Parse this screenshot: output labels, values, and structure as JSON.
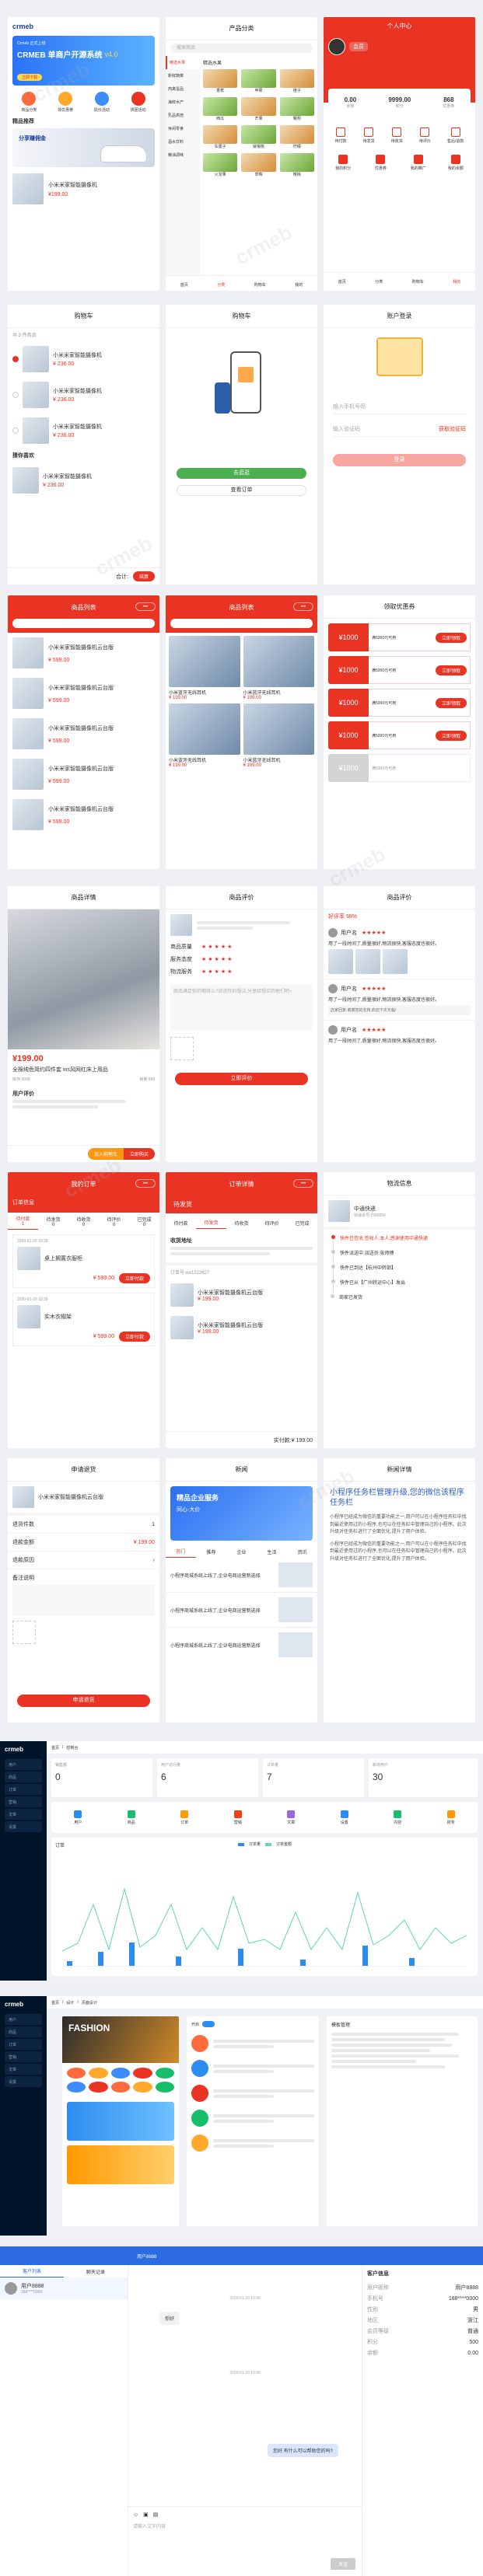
{
  "brand": "crmeb",
  "watermark": "crmeb",
  "colors": {
    "primary": "#e93323",
    "admin_side": "#001529",
    "admin_blue": "#2d8cf0"
  },
  "home": {
    "banner_title": "CRMEB 单商户开源系统",
    "banner_version": "v4.0",
    "banner_small": "Crmeb 正式上线",
    "banner_cta": "立即下载",
    "nav": [
      "商品分类",
      "领优惠券",
      "砍价活动",
      "拼团活动"
    ],
    "notice": "精品推荐",
    "promo": "分享赚佣金",
    "product": "小米米家智能摄像机",
    "price": "¥199.00"
  },
  "category": {
    "title": "产品分类",
    "search": "搜索商品",
    "side": [
      "精选水果",
      "新鲜蔬菜",
      "肉禽蛋品",
      "海鲜水产",
      "乳品烘焙",
      "休闲零食",
      "酒水饮料",
      "粮油调味"
    ],
    "sub": "精选水果",
    "items": [
      "香蕉",
      "苹果",
      "橙子",
      "西瓜",
      "芒果",
      "葡萄",
      "车厘子",
      "猕猴桃",
      "柠檬",
      "火龙果",
      "草莓",
      "樱桃"
    ]
  },
  "user": {
    "title": "个人中心",
    "name": "会员",
    "stats": [
      "余额",
      "积分",
      "优惠券"
    ],
    "values": [
      "0.00",
      "9999.00",
      "868"
    ],
    "orders": [
      "待付款",
      "待发货",
      "待收货",
      "待评价",
      "售后/退款"
    ],
    "services": [
      "我的积分",
      "优惠券",
      "我的推广",
      "我的余额"
    ],
    "tabbar": [
      "首页",
      "分类",
      "购物车",
      "我的"
    ]
  },
  "cart": {
    "title": "购物车",
    "tip": "共 3 件商品",
    "product": "小米米家智能摄像机",
    "price": "¥ 236.00",
    "other": "猜你喜欢",
    "total": "合计:",
    "checkout": "结算"
  },
  "cart_empty": {
    "title": "购物车",
    "btn1": "去逛逛",
    "btn2": "查看订单"
  },
  "login": {
    "title": "账户登录",
    "phone_placeholder": "输入手机号码",
    "code_placeholder": "输入验证码",
    "get_code": "获取验证码",
    "submit": "登录"
  },
  "list1": {
    "title": "商品列表",
    "items": [
      "小米米家智能摄像机云台版",
      "小米米家智能摄像机云台版",
      "小米米家智能摄像机云台版",
      "小米米家智能摄像机云台版",
      "小米米家智能摄像机云台版"
    ],
    "price": "¥ 599.00"
  },
  "list2": {
    "title": "商品列表",
    "items": [
      "小米蓝牙无线耳机",
      "小米蓝牙无线耳机",
      "小米蓝牙无线耳机",
      "小米蓝牙无线耳机"
    ],
    "price": "¥ 199.00"
  },
  "coupons": {
    "title": "领取优惠券",
    "amount": "¥1000",
    "desc": "满5000元可用",
    "take": "立即领取"
  },
  "detail": {
    "title": "商品详情",
    "price": "¥199.00",
    "name": "全棉纯色简约四件套 ins风网红床上用品",
    "stock": "库存:9999",
    "sales": "销量:688",
    "evaluate": "用户评价",
    "buy": "立即购买",
    "cart": "加入购物车"
  },
  "evaluate": {
    "title": "商品评价",
    "labels": [
      "商品质量",
      "服务态度",
      "物流服务"
    ],
    "placeholder": "商品满足你的期待么?说说你的想法,分享给想买的他们吧~",
    "submit": "立即评价"
  },
  "reviews": {
    "title": "商品评价",
    "rate": "好评率 98%",
    "users": [
      "用户名",
      "用户名",
      "用户名"
    ],
    "text": "用了一段时间了,质量很好,物流很快,客服态度也很好。",
    "reply": "店家回复:谢谢您的支持,欢迎下次光临!"
  },
  "orders": {
    "title": "我的订单",
    "head": "订单信息",
    "counts": [
      "1",
      "0",
      "0",
      "0",
      "0"
    ],
    "tabs": [
      "待付款",
      "待发货",
      "待收货",
      "待评价",
      "已完成"
    ],
    "time": "2020-01-20 10:38",
    "items": [
      "桌上搁置衣服柜",
      "实木衣帽架"
    ],
    "price": "¥ 599.00",
    "btn": "立即付款"
  },
  "order_detail": {
    "title": "订单详情",
    "status": "待发货",
    "steps": [
      "待付款",
      "待发货",
      "待收货",
      "待评价",
      "已完成"
    ],
    "address": "收货地址",
    "order_no": "订单号:wx1523627",
    "goods": "小米米家智能摄像机云台版",
    "price": "¥ 199.00",
    "total": "实付款:¥ 199.00"
  },
  "logistics": {
    "title": "物流信息",
    "company": "中通快递",
    "no": "快递单号:7580256",
    "events": [
      "快件已签收,签收人:本人,感谢使用中通快递",
      "快件派送中,派送员:张师傅",
      "快件已到达【杭州中转部】",
      "快件已从【广州转运中心】发出",
      "商家已发货"
    ]
  },
  "apply": {
    "title": "申请退货",
    "product": "小米米家智能摄像机云台版",
    "fields": [
      "退货件数",
      "退款金额",
      "退款原因",
      "备注说明"
    ],
    "amount": "¥ 199.00",
    "submit": "申请退货"
  },
  "news": {
    "title": "新闻",
    "banner_title": "精品企业服务",
    "banner_sub": "同心·大价",
    "tabs": [
      "热门",
      "推荐",
      "企业",
      "生活",
      "资讯"
    ],
    "items": [
      "小程序商城系统上线了,企业电商运营新选择",
      "小程序商城系统上线了,企业电商运营新选择",
      "小程序商城系统上线了,企业电商运营新选择"
    ]
  },
  "news_detail": {
    "title": "新闻详情",
    "heading": "小程序任务栏管理升级,您的微信该程序任务栏",
    "body": "小程序已经成为微信的重要功能之一,用户可以在小程序任务栏中找到最近使用过的小程序,也可以在任务栏中管理自己的小程序。此次升级对任务栏进行了全面优化,提升了用户体验。"
  },
  "admin1": {
    "logo": "crmeb",
    "crumbs": [
      "首页",
      "控制台"
    ],
    "cards": [
      "销售额",
      "用户访问量",
      "订单量",
      "新增用户"
    ],
    "values": [
      "0",
      "6",
      "7",
      "30"
    ],
    "quick": [
      "用户",
      "商品",
      "订单",
      "营销",
      "文章",
      "设置",
      "内容",
      "财务"
    ],
    "chart_title": "订单",
    "legend": [
      "订单量",
      "订单金额"
    ]
  },
  "admin2": {
    "logo": "crmeb",
    "crumbs": [
      "首页",
      "设计",
      "页面设计"
    ],
    "banner": "FASHION",
    "switch": "开启",
    "label": "模板管理"
  },
  "chat": {
    "tabs": [
      "客户列表",
      "聊天记录"
    ],
    "customer": "用户8888",
    "phone": "188****0000",
    "time": "2020-01-20 10:38",
    "msg_in": "你好",
    "msg_out": "您好,有什么可以帮助您的吗?",
    "input": "请输入文字内容",
    "send": "发送",
    "info_title": "客户信息",
    "info": [
      "用户昵称",
      "手机号",
      "性别",
      "地区",
      "会员等级",
      "积分",
      "余额"
    ],
    "info_values": [
      "用户8888",
      "188****0000",
      "男",
      "浙江",
      "普通",
      "500",
      "0.00"
    ]
  }
}
